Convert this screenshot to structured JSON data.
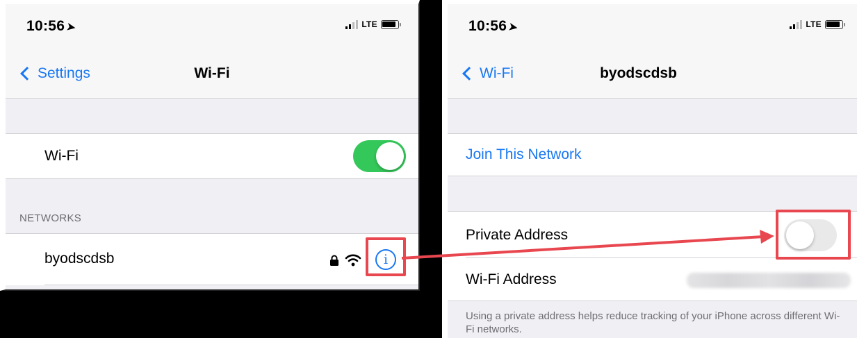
{
  "left_screen": {
    "status": {
      "time": "10:56",
      "location_glyph": "➤",
      "network": "LTE"
    },
    "nav": {
      "back_label": "Settings",
      "title": "Wi-Fi"
    },
    "wifi_row": {
      "label": "Wi-Fi",
      "toggle_on": true
    },
    "networks_header": "NETWORKS",
    "networks": [
      {
        "name": "byodscdsb",
        "secured": true
      }
    ],
    "info_glyph": "i"
  },
  "right_screen": {
    "status": {
      "time": "10:56",
      "location_glyph": "➤",
      "network": "LTE"
    },
    "nav": {
      "back_label": "Wi-Fi",
      "title": "byodscdsb"
    },
    "join_label": "Join This Network",
    "private_address": {
      "label": "Private Address",
      "toggle_on": false
    },
    "wifi_address_label": "Wi-Fi Address",
    "footer_note": "Using a private address helps reduce tracking of your iPhone across different Wi-Fi networks."
  },
  "colors": {
    "ios_blue": "#1877f2",
    "switch_green": "#34c759",
    "highlight_red": "#e8474f"
  },
  "icons": {
    "lock": "lock-icon",
    "wifi": "wifi-signal-icon",
    "info": "info-icon",
    "battery": "battery-icon",
    "signal": "cellular-signal-icon"
  }
}
